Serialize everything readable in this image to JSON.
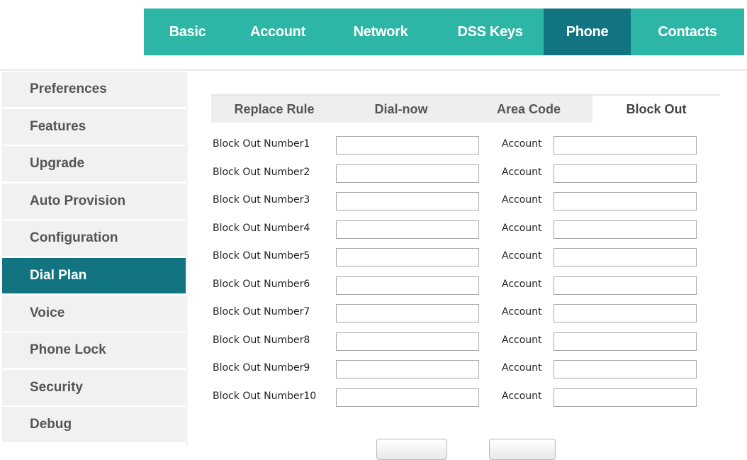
{
  "topnav": {
    "tabs": [
      {
        "label": "Basic"
      },
      {
        "label": "Account"
      },
      {
        "label": "Network"
      },
      {
        "label": "DSS Keys"
      },
      {
        "label": "Phone"
      },
      {
        "label": "Contacts"
      }
    ],
    "active": "Phone"
  },
  "sidebar": {
    "items": [
      {
        "label": "Preferences"
      },
      {
        "label": "Features"
      },
      {
        "label": "Upgrade"
      },
      {
        "label": "Auto Provision"
      },
      {
        "label": "Configuration"
      },
      {
        "label": "Dial Plan"
      },
      {
        "label": "Voice"
      },
      {
        "label": "Phone Lock"
      },
      {
        "label": "Security"
      },
      {
        "label": "Debug"
      }
    ],
    "active": "Dial Plan"
  },
  "subtabs": {
    "items": [
      {
        "label": "Replace Rule"
      },
      {
        "label": "Dial-now"
      },
      {
        "label": "Area Code"
      },
      {
        "label": "Block Out"
      }
    ],
    "active": "Block Out"
  },
  "form": {
    "account_label": "Account",
    "rows": [
      {
        "label": "Block Out Number1",
        "value": "",
        "account": ""
      },
      {
        "label": "Block Out Number2",
        "value": "",
        "account": ""
      },
      {
        "label": "Block Out Number3",
        "value": "",
        "account": ""
      },
      {
        "label": "Block Out Number4",
        "value": "",
        "account": ""
      },
      {
        "label": "Block Out Number5",
        "value": "",
        "account": ""
      },
      {
        "label": "Block Out Number6",
        "value": "",
        "account": ""
      },
      {
        "label": "Block Out Number7",
        "value": "",
        "account": ""
      },
      {
        "label": "Block Out Number8",
        "value": "",
        "account": ""
      },
      {
        "label": "Block Out Number9",
        "value": "",
        "account": ""
      },
      {
        "label": "Block Out Number10",
        "value": "",
        "account": ""
      }
    ]
  },
  "colors": {
    "nav_bg": "#2db6a6",
    "nav_active": "#127480",
    "sidebar_bg": "#f1f1f1",
    "sidebar_text": "#555555"
  }
}
